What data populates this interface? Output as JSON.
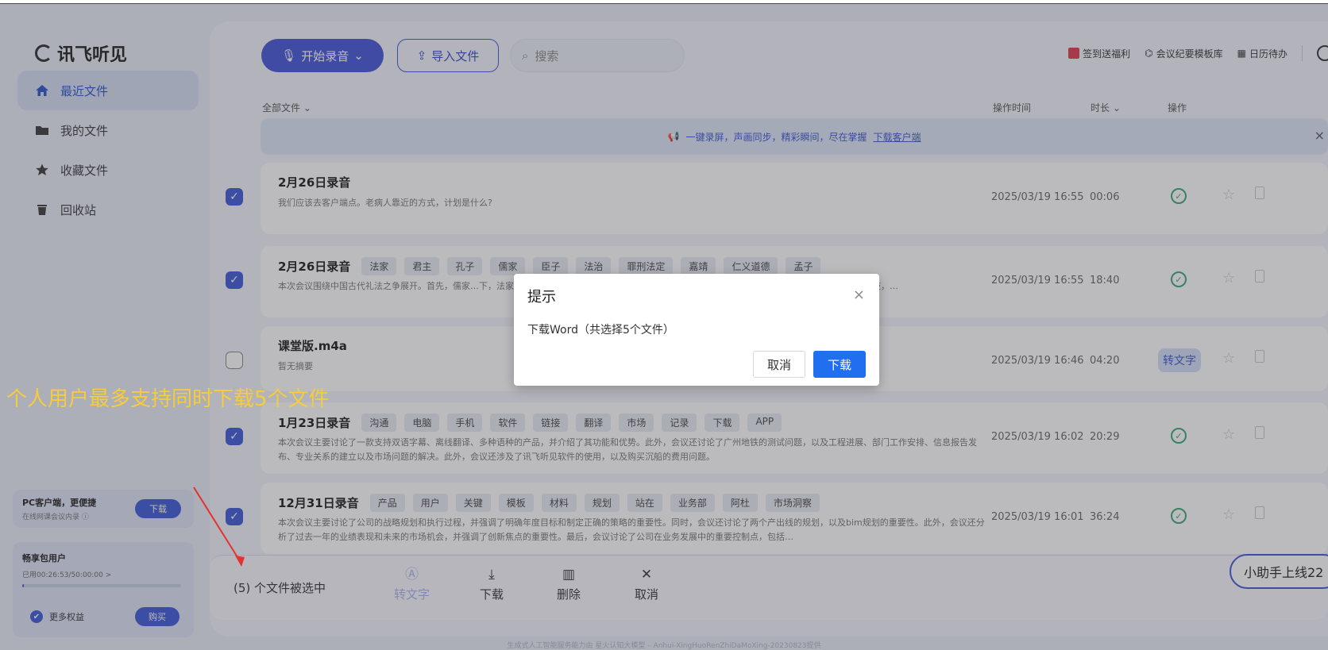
{
  "app": {
    "logo_text": "讯飞听见"
  },
  "sidebar": {
    "items": [
      {
        "label": "最近文件",
        "icon": "home-icon",
        "active": true
      },
      {
        "label": "我的文件",
        "icon": "folder-icon",
        "active": false
      },
      {
        "label": "收藏文件",
        "icon": "star-icon",
        "active": false
      },
      {
        "label": "回收站",
        "icon": "trash-icon",
        "active": false
      }
    ],
    "pc_promo": {
      "title": "PC客户端，更便捷",
      "subtitle": "在线网课会议内录 ⓘ",
      "button": "下载"
    },
    "vip": {
      "title": "畅享包用户",
      "usage": "已用00:26:53/50:00:00 >",
      "usage_fraction": 0.009,
      "more": "更多权益",
      "buy": "购买"
    }
  },
  "toolbar": {
    "record_label": "开始录音",
    "import_label": "导入文件",
    "search_placeholder": "搜索",
    "links": [
      {
        "label": "签到送福利",
        "icon": "gift-icon",
        "color": "#e0394a"
      },
      {
        "label": "会议纪要模板库",
        "icon": "template-icon",
        "color": "#333333"
      },
      {
        "label": "日历待办",
        "icon": "calendar-icon",
        "color": "#333333"
      }
    ]
  },
  "list_header": {
    "filter": "全部文件 ⌄",
    "time": "操作时间",
    "duration": "时长 ⌄",
    "actions": "操作"
  },
  "banner": {
    "text": "一键录屏，声画同步，精彩瞬间，尽在掌握",
    "link": "下载客户端",
    "close": "×"
  },
  "files": [
    {
      "title": "2月26日录音",
      "tags": [],
      "desc": "我们应该去客户端点。老病人靠近的方式，计划是什么?",
      "time": "2025/03/19 16:55",
      "duration": "00:06",
      "checked": true,
      "status": "done"
    },
    {
      "title": "2月26日录音",
      "tags": [
        "法家",
        "君主",
        "孔子",
        "儒家",
        "臣子",
        "法治",
        "罪刑法定",
        "嘉靖",
        "仁义道德",
        "孟子"
      ],
      "desc": "本次会议围绕中国古代礼法之争展开。首先，儒家…下，法家的人治则是强人之志，即以利而为，力寡者则朝于人。其次，孔子对…在法律上存在根本性分歧，…",
      "time": "2025/03/19 16:55",
      "duration": "18:40",
      "checked": true,
      "status": "done"
    },
    {
      "title": "课堂版.m4a",
      "tags": [],
      "desc": "暂无摘要",
      "time": "2025/03/19 16:46",
      "duration": "04:20",
      "checked": false,
      "status": "transcribe",
      "transcribe_label": "转文字"
    },
    {
      "title": "1月23日录音",
      "tags": [
        "沟通",
        "电脑",
        "手机",
        "软件",
        "链接",
        "翻译",
        "市场",
        "记录",
        "下载",
        "APP"
      ],
      "desc": "本次会议主要讨论了一款支持双语字幕、离线翻译、多种语种的产品，并介绍了其功能和优势。此外，会议还讨论了广州地铁的测试问题，以及工程进展、部门工作安排、信息报告发布、专业关系的建立以及市场问题的解决。此外，会议还涉及了讯飞听见软件的使用，以及购买沉船的费用问题。",
      "time": "2025/03/19 16:02",
      "duration": "20:29",
      "checked": true,
      "status": "done"
    },
    {
      "title": "12月31日录音",
      "tags": [
        "产品",
        "用户",
        "关键",
        "模板",
        "材料",
        "规划",
        "站在",
        "业务部",
        "阿杜",
        "市场洞察"
      ],
      "desc": "本次会议主要讨论了公司的战略规划和执行过程，并强调了明确年度目标和制定正确的策略的重要性。同时，会议还讨论了两个产出线的规划，以及bim规划的重要性。此外，会议还分析了过去一年的业绩表现和未来的市场机会，并强调了创新焦点的重要性。最后，会议讨论了公司在业务发展中的重要控制点，包括…",
      "time": "2025/03/19 16:01",
      "duration": "36:24",
      "checked": true,
      "status": "done"
    }
  ],
  "bottom_bar": {
    "selected_text": "(5) 个文件被选中",
    "actions": [
      {
        "label": "转文字",
        "icon": "transcribe-icon",
        "glyph": "Ⓐ",
        "disabled": true
      },
      {
        "label": "下载",
        "icon": "download-icon",
        "glyph": "⤓",
        "disabled": false
      },
      {
        "label": "删除",
        "icon": "trash-icon",
        "glyph": "🗑",
        "disabled": false
      },
      {
        "label": "取消",
        "icon": "close-icon",
        "glyph": "✕",
        "disabled": false
      }
    ],
    "helper": "小助手上线22"
  },
  "footer": "生成式人工智能服务能力由 星火认知大模型 – Anhui-XingHuoRenZhiDaMoXing-20230823提供",
  "annotation": "个人用户最多支持同时下载5个文件",
  "dialog": {
    "title": "提示",
    "close": "×",
    "body": "下载Word（共选择5个文件）",
    "cancel": "取消",
    "confirm": "下载"
  },
  "colors": {
    "accent": "#3d56d8",
    "confirm": "#1f6ff0",
    "annotation": "#f6cc3a",
    "status_ok": "#3aa676"
  }
}
